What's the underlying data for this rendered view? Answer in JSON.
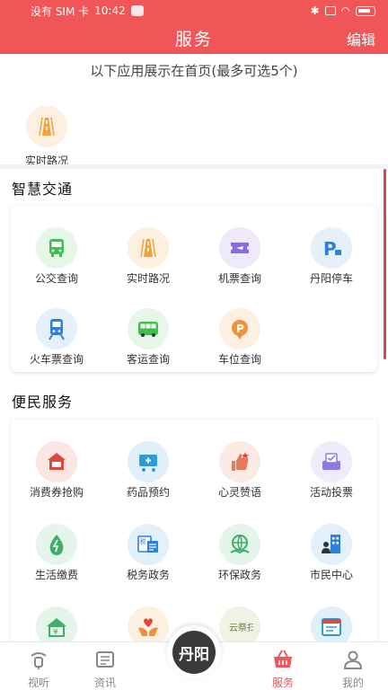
{
  "status_bar": {
    "carrier": "没有 SIM 卡",
    "time": "10:42"
  },
  "nav": {
    "title": "服务",
    "edit": "编辑"
  },
  "home": {
    "hint": "以下应用展示在首页(最多可选5个)",
    "items": [
      {
        "label": "实时路况",
        "icon": "road-icon"
      }
    ]
  },
  "sections": [
    {
      "title": "智慧交通",
      "items": [
        {
          "label": "公交查询",
          "icon": "bus-icon",
          "color": "#3fbf4f",
          "bg": "#e6f7e8"
        },
        {
          "label": "实时路况",
          "icon": "road-icon",
          "color": "#f0a23b",
          "bg": "#fdf0e0"
        },
        {
          "label": "机票查询",
          "icon": "ticket-icon",
          "color": "#8b6be0",
          "bg": "#efeafb"
        },
        {
          "label": "丹阳停车",
          "icon": "parking-icon",
          "color": "#2f80d8",
          "bg": "#e6f0fb"
        },
        {
          "label": "火车票查询",
          "icon": "train-icon",
          "color": "#2f80d8",
          "bg": "#e6f0fb"
        },
        {
          "label": "客运查询",
          "icon": "coach-icon",
          "color": "#3fbf4f",
          "bg": "#e6f7e8"
        },
        {
          "label": "车位查询",
          "icon": "parking-spot-icon",
          "color": "#f0913b",
          "bg": "#fdf0e0"
        }
      ]
    },
    {
      "title": "便民服务",
      "items": [
        {
          "label": "消费券抢购",
          "icon": "coupon-icon",
          "color": "#e0473d",
          "bg": "#fbe6e4"
        },
        {
          "label": "药品预约",
          "icon": "cart-icon",
          "color": "#2f9ad8",
          "bg": "#dff0fb"
        },
        {
          "label": "心灵赞语",
          "icon": "thumbs-up-icon",
          "color": "#e37a5c",
          "bg": "#fcebe5"
        },
        {
          "label": "活动投票",
          "icon": "vote-icon",
          "color": "#8b7be0",
          "bg": "#efedfb"
        },
        {
          "label": "生活缴费",
          "icon": "water-drop-icon",
          "color": "#3fae6a",
          "bg": "#e4f5ea"
        },
        {
          "label": "税务政务",
          "icon": "tax-doc-icon",
          "color": "#2f80d8",
          "bg": "#e2f0fb"
        },
        {
          "label": "环保政务",
          "icon": "globe-leaf-icon",
          "color": "#3fae6a",
          "bg": "#e4f5ea"
        },
        {
          "label": "市民中心",
          "icon": "building-person-icon",
          "color": "#2f80d8",
          "bg": "#e2f0fb"
        },
        {
          "label": "",
          "icon": "house-yuan-icon",
          "color": "#3fae6a",
          "bg": "#e4f5ea"
        },
        {
          "label": "",
          "icon": "heart-hands-icon",
          "color": "#f0913b",
          "bg": "#fdf0e0"
        },
        {
          "label": "",
          "icon": "yun-ji-sao-icon",
          "color": "#5a8a3a",
          "bg": "#eef3e4",
          "text": "云祭扫"
        },
        {
          "label": "",
          "icon": "calendar-icon",
          "color": "#2f9ad8",
          "bg": "#dff0fb"
        }
      ]
    }
  ],
  "tabbar": {
    "tabs": [
      {
        "label": "视听",
        "icon": "broadcast-icon"
      },
      {
        "label": "资讯",
        "icon": "news-icon"
      },
      {
        "label": "",
        "icon": "logo"
      },
      {
        "label": "服务",
        "icon": "basket-icon",
        "active": true
      },
      {
        "label": "我的",
        "icon": "user-icon"
      }
    ],
    "center_logo": "丹阳"
  }
}
